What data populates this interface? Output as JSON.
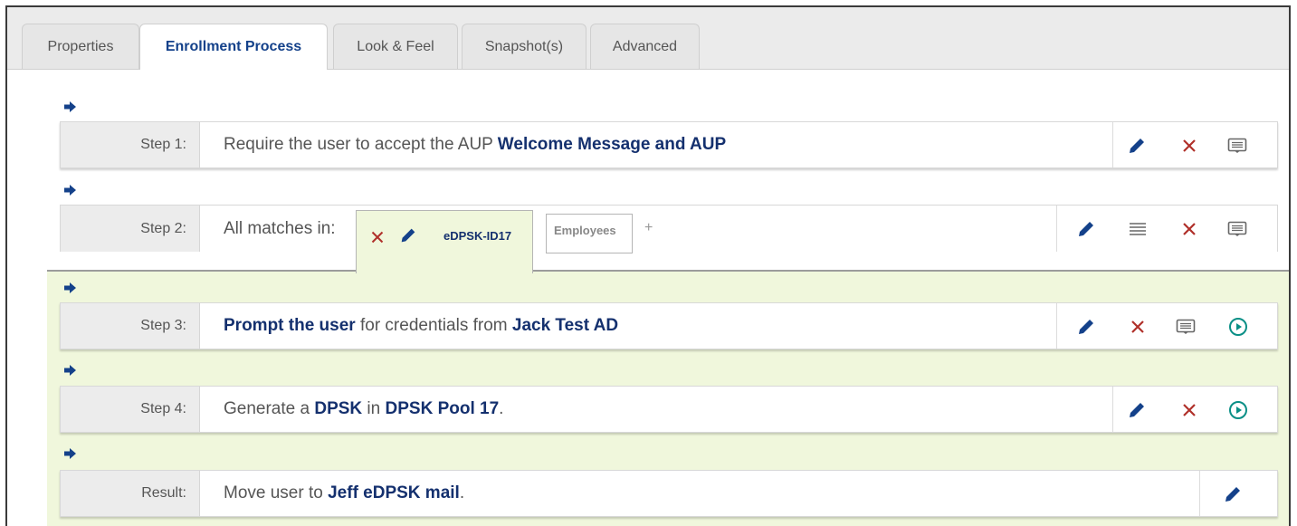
{
  "tabs": [
    "Properties",
    "Enrollment Process",
    "Look & Feel",
    "Snapshot(s)",
    "Advanced"
  ],
  "active_tab": "Enrollment Process",
  "steps": [
    {
      "label": "Step 1:",
      "t1": "Require the user to accept the AUP ",
      "b1": "Welcome Message and AUP"
    },
    {
      "label": "Step 2:",
      "t1": "All matches in:",
      "tab_active": "eDPSK-ID17",
      "tab_other": "Employees",
      "add": "+"
    },
    {
      "label": "Step 3:",
      "b1": "Prompt the user",
      "t1": " for credentials from ",
      "b2": "Jack Test AD"
    },
    {
      "label": "Step 4:",
      "t1": "Generate a ",
      "b1": "DPSK",
      "t2": " in ",
      "b2": "DPSK Pool 17",
      "t3": "."
    },
    {
      "label": "Result:",
      "t1": "Move user to ",
      "b1": "Jeff eDPSK mail",
      "t2": "."
    }
  ],
  "colors": {
    "accent": "#14418a",
    "delete": "#b0302a",
    "green_bg": "#f0f7dc",
    "run": "#0a8f86"
  }
}
